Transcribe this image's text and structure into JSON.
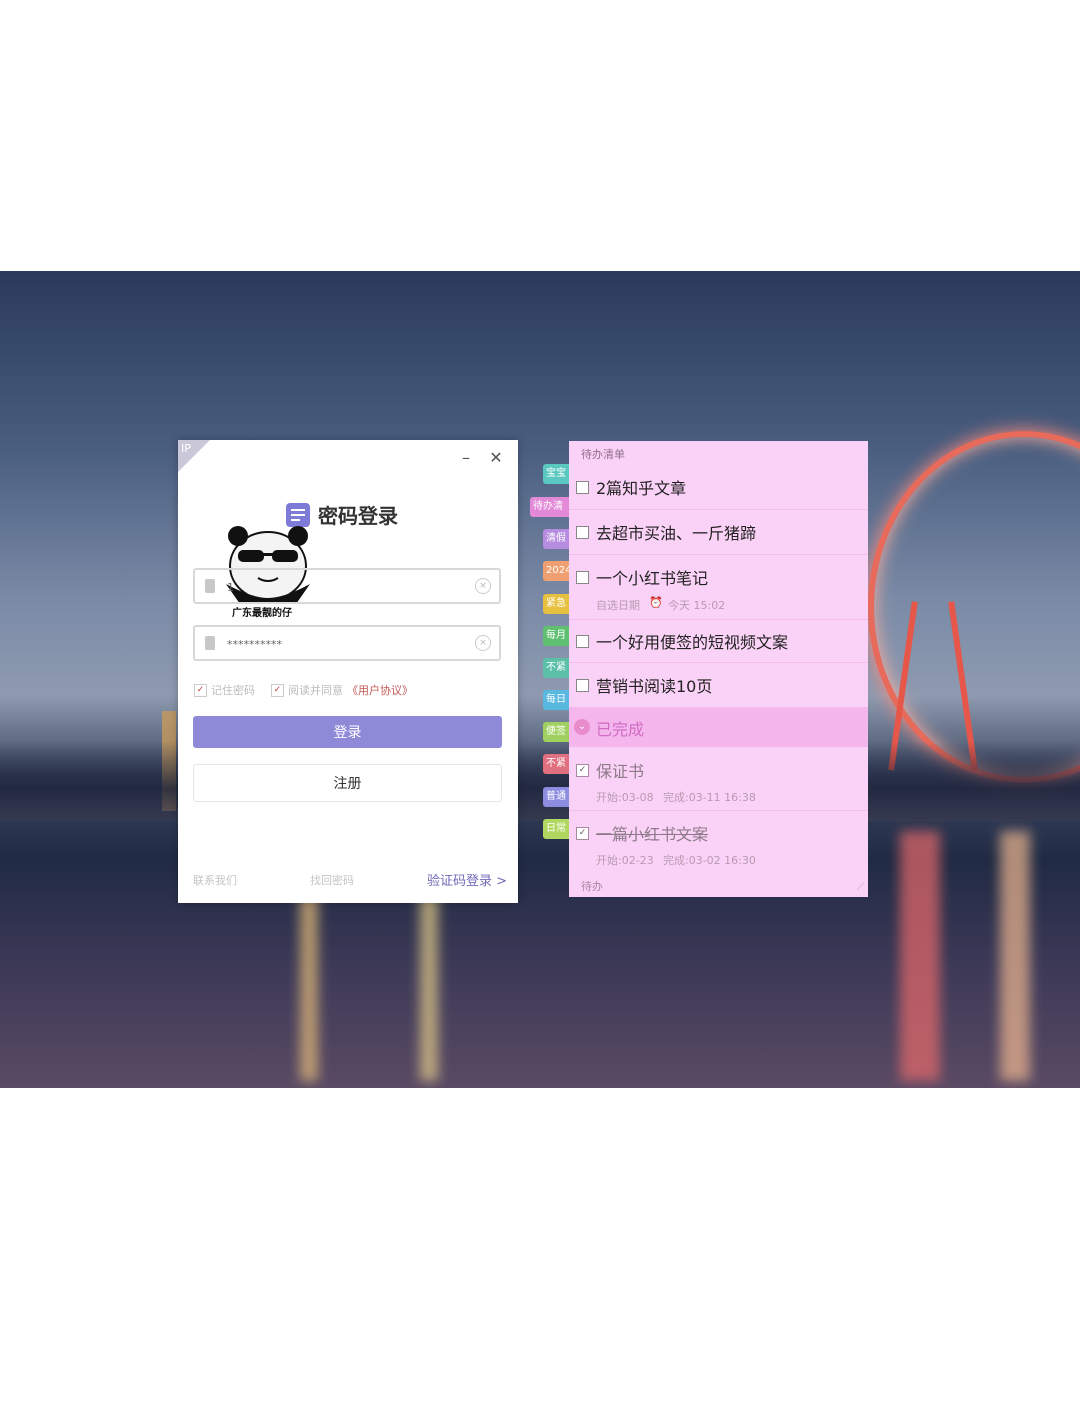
{
  "login": {
    "ip_badge": "IP",
    "minimize": "–",
    "close": "✕",
    "title": "密码登录",
    "sticker_caption": "广东最靓的仔",
    "account_value": "1",
    "password_value": "**********",
    "clear_glyph": "×",
    "remember_label": "记住密码",
    "agree_label": "阅读并同意",
    "agreement_link": "《用户协议》",
    "check_mark": "✓",
    "login_button": "登录",
    "register_button": "注册",
    "contact": "联系我们",
    "recover": "找回密码",
    "sms_login": "验证码登录 >"
  },
  "side_tabs": [
    {
      "label": "宝宝",
      "color": "#5ac8c0"
    },
    {
      "label": "待办清",
      "color": "#e28ad8"
    },
    {
      "label": "清假",
      "color": "#b58ce0"
    },
    {
      "label": "2024",
      "color": "#f0a070"
    },
    {
      "label": "紧急",
      "color": "#e8c040"
    },
    {
      "label": "每月",
      "color": "#5ec070"
    },
    {
      "label": "不紧",
      "color": "#5cc0a8"
    },
    {
      "label": "每日",
      "color": "#58b8e0"
    },
    {
      "label": "便签",
      "color": "#a0d060"
    },
    {
      "label": "不紧",
      "color": "#e07080"
    },
    {
      "label": "普通",
      "color": "#8c8ce0"
    },
    {
      "label": "日常",
      "color": "#b0d860"
    }
  ],
  "todo": {
    "header": "待办清单",
    "pending": [
      {
        "text": "2篇知乎文章"
      },
      {
        "text": "去超市买油、一斤猪蹄"
      },
      {
        "text": "一个小红书笔记",
        "sub_date": "自选日期",
        "sub_time": "今天 15:02"
      },
      {
        "text": "一个好用便签的短视频文案"
      },
      {
        "text": "营销书阅读10页"
      }
    ],
    "done_header": "已完成",
    "done_chevron": "⌄",
    "done": [
      {
        "text": "保证书",
        "start": "开始:03-08",
        "finish": "完成:03-11 16:38"
      },
      {
        "text": "一篇小红书文案",
        "start": "开始:02-23",
        "finish": "完成:03-02 16:30"
      }
    ],
    "done_check": "✓",
    "footer": "待办",
    "resize_glyph": "⟋",
    "alarm_glyph": "⏰"
  }
}
